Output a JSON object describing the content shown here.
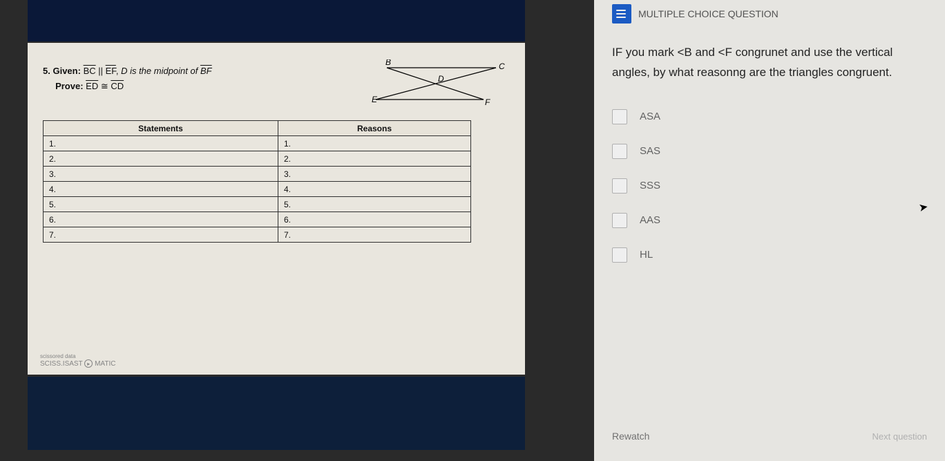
{
  "worksheet": {
    "problem_number": "5.",
    "given_label": "Given:",
    "given_text_1": "BC",
    "given_parallel": "||",
    "given_text_2": "EF",
    "given_sep": ",",
    "given_midpoint": "D is the midpoint of",
    "given_segment": "BF",
    "prove_label": "Prove:",
    "prove_seg1": "ED",
    "prove_cong": "≅",
    "prove_seg2": "CD",
    "figure_labels": {
      "B": "B",
      "C": "C",
      "D": "D",
      "E": "E",
      "F": "F"
    },
    "table_headers": {
      "statements": "Statements",
      "reasons": "Reasons"
    },
    "rows": [
      "1.",
      "2.",
      "3.",
      "4.",
      "5.",
      "6.",
      "7."
    ],
    "watermark_small": "scissored data",
    "watermark_brand": "SCISS.ISAST",
    "watermark_tag": "MATIC"
  },
  "quiz": {
    "header": "MULTIPLE CHOICE QUESTION",
    "question": "IF you mark <B and <F congrunet and use the vertical angles, by what reasonng are the triangles congruent.",
    "options": [
      "ASA",
      "SAS",
      "SSS",
      "AAS",
      "HL"
    ],
    "rewatch": "Rewatch",
    "next": "Next question"
  }
}
